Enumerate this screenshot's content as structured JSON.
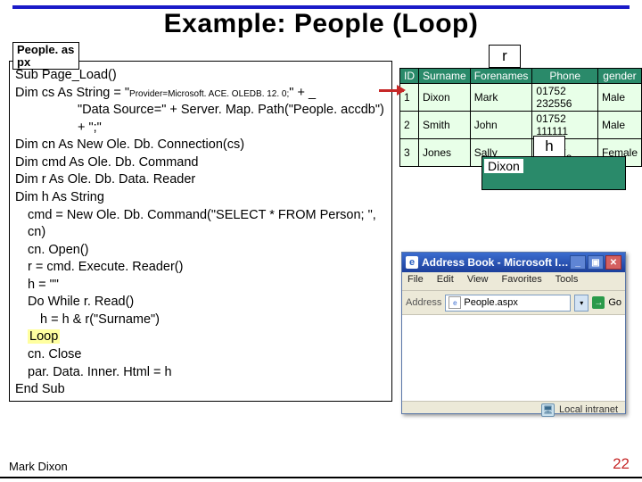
{
  "title": "Example: People (Loop)",
  "file_label_l1": "People. as",
  "file_label_l2": "px",
  "code": {
    "l1": "Sub Page_Load()",
    "l2a": "Dim cs As String = \"",
    "l2b": "Provider=Microsoft. ACE. OLEDB. 12. 0;",
    "l2c": "\" + _",
    "l3": "\"Data Source=\" + Server. Map. Path(\"People. accdb\") + \";\"",
    "l4": "Dim cn   As New Ole. Db. Connection(cs)",
    "l5": "Dim cmd  As Ole. Db. Command",
    "l6": "Dim r   As Ole. Db. Data. Reader",
    "l7": "Dim h   As String",
    "l8": "cmd = New Ole. Db. Command(\"SELECT * FROM Person; \", cn)",
    "l9": "cn. Open()",
    "l10": "r = cmd. Execute. Reader()",
    "l11": "h = \"\"",
    "l12": "Do While r. Read()",
    "l13": "h = h & r(\"Surname\")",
    "l14": "Loop",
    "l15": "cn. Close",
    "l16": "par. Data. Inner. Html = h",
    "l17": "End Sub"
  },
  "callout_r": "r",
  "callout_h": "h",
  "h_value": "Dixon",
  "table": {
    "headers": [
      "ID",
      "Surname",
      "Forenames",
      "Phone",
      "gender"
    ],
    "rows": [
      [
        "1",
        "Dixon",
        "Mark",
        "01752 232556",
        "Male"
      ],
      [
        "2",
        "Smith",
        "John",
        "01752 111111",
        "Male"
      ],
      [
        "3",
        "Jones",
        "Sally",
        "01752 888888",
        "Female"
      ]
    ]
  },
  "browser": {
    "title": "Address Book - Microsoft I…",
    "menu": [
      "File",
      "Edit",
      "View",
      "Favorites",
      "Tools"
    ],
    "addr_label": "Address",
    "url": "People.aspx",
    "go_label": "Go",
    "status": "Local intranet"
  },
  "footer_author": "Mark Dixon",
  "footer_page": "22"
}
